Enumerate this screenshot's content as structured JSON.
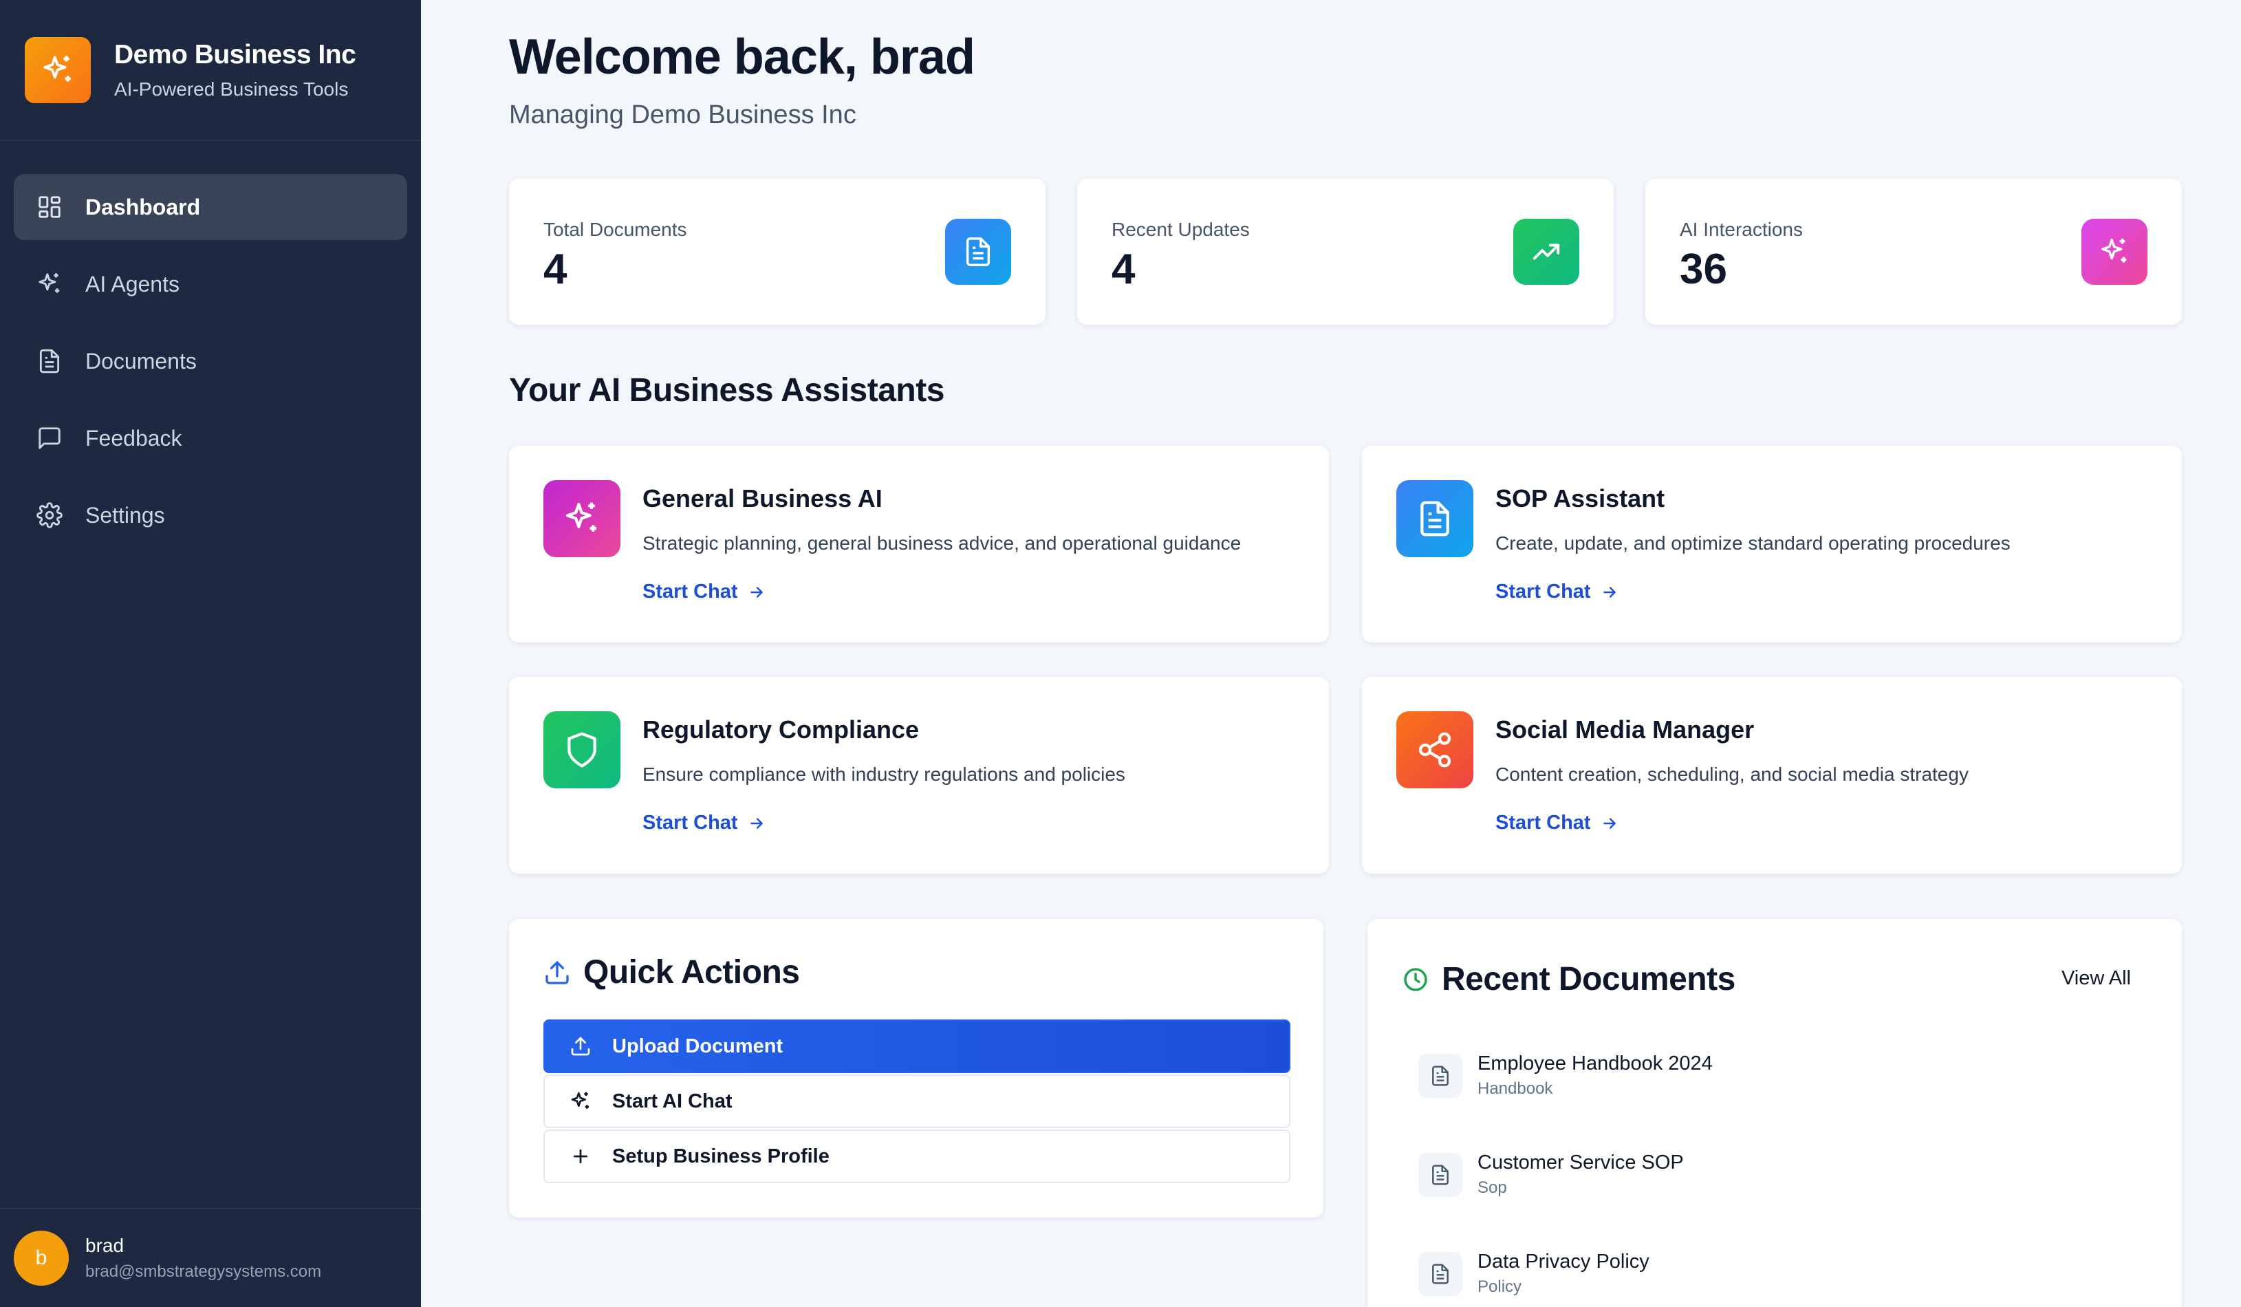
{
  "brand": {
    "title": "Demo Business Inc",
    "subtitle": "AI-Powered Business Tools",
    "logo_icon": "sparkles-icon",
    "logo_color": "#f59e0b"
  },
  "sidebar": {
    "items": [
      {
        "label": "Dashboard",
        "icon": "dashboard-grid-icon",
        "active": true
      },
      {
        "label": "AI Agents",
        "icon": "sparkles-icon",
        "active": false
      },
      {
        "label": "Documents",
        "icon": "document-icon",
        "active": false
      },
      {
        "label": "Feedback",
        "icon": "message-icon",
        "active": false
      },
      {
        "label": "Settings",
        "icon": "gear-icon",
        "active": false
      }
    ]
  },
  "user": {
    "initial": "b",
    "name": "brad",
    "email": "brad@smbstrategysystems.com"
  },
  "header": {
    "welcome": "Welcome back, brad",
    "subtitle": "Managing Demo Business Inc"
  },
  "stats": [
    {
      "label": "Total Documents",
      "value": "4",
      "icon": "document-icon",
      "color": "#2563eb"
    },
    {
      "label": "Recent Updates",
      "value": "4",
      "icon": "trending-up-icon",
      "color": "#16a34a"
    },
    {
      "label": "AI Interactions",
      "value": "36",
      "icon": "sparkles-icon",
      "color": "#c026d3"
    }
  ],
  "assistants": {
    "title": "Your AI Business Assistants",
    "items": [
      {
        "name": "General Business AI",
        "desc": "Strategic planning, general business advice, and operational guidance",
        "link": "Start Chat",
        "icon": "sparkles-icon",
        "color": "#c026d3"
      },
      {
        "name": "SOP Assistant",
        "desc": "Create, update, and optimize standard operating procedures",
        "link": "Start Chat",
        "icon": "document-icon",
        "color": "#2563eb"
      },
      {
        "name": "Regulatory Compliance",
        "desc": "Ensure compliance with industry regulations and policies",
        "link": "Start Chat",
        "icon": "shield-icon",
        "color": "#16a34a"
      },
      {
        "name": "Social Media Manager",
        "desc": "Content creation, scheduling, and social media strategy",
        "link": "Start Chat",
        "icon": "share-icon",
        "color": "#ea580c"
      }
    ]
  },
  "quick_actions": {
    "title": "Quick Actions",
    "items": [
      {
        "label": "Upload Document",
        "icon": "upload-icon"
      },
      {
        "label": "Start AI Chat",
        "icon": "sparkles-icon"
      },
      {
        "label": "Setup Business Profile",
        "icon": "plus-icon"
      }
    ]
  },
  "recent_documents": {
    "title": "Recent Documents",
    "view_all": "View All",
    "items": [
      {
        "name": "Employee Handbook 2024",
        "type": "Handbook"
      },
      {
        "name": "Customer Service SOP",
        "type": "Sop"
      },
      {
        "name": "Data Privacy Policy",
        "type": "Policy"
      }
    ]
  }
}
